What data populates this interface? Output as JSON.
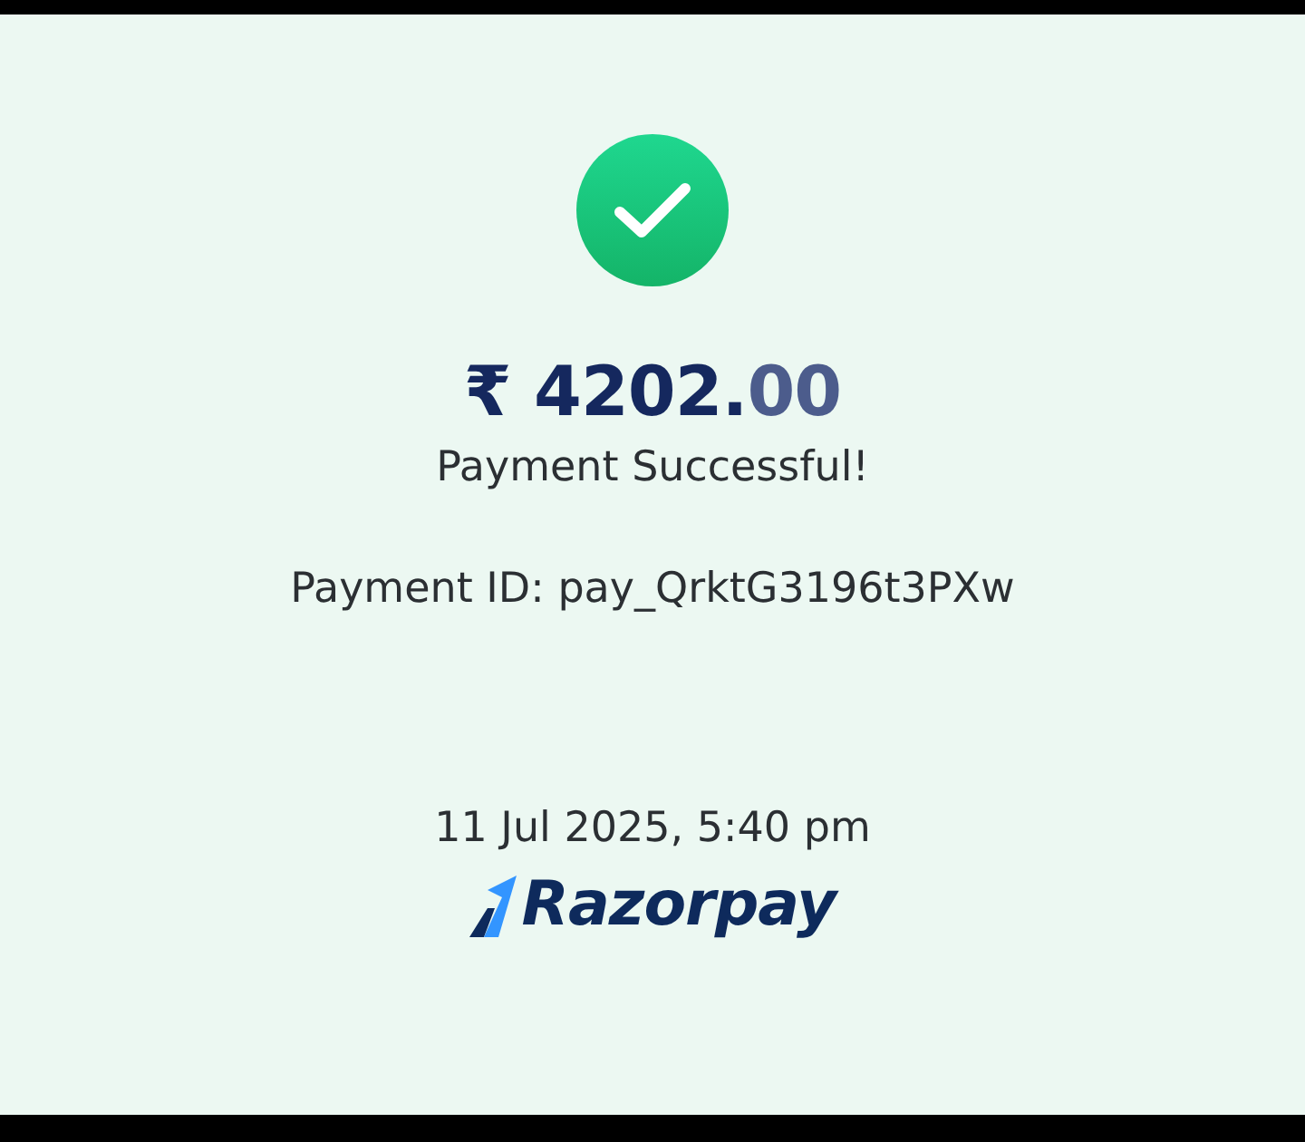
{
  "amount": {
    "currency_and_whole": "₹ 4202.",
    "fraction": "00"
  },
  "status": "Payment Successful!",
  "payment_id": "Payment ID: pay_QrktG3196t3PXw",
  "timestamp": "11 Jul 2025, 5:40 pm",
  "brand": "Razorpay"
}
